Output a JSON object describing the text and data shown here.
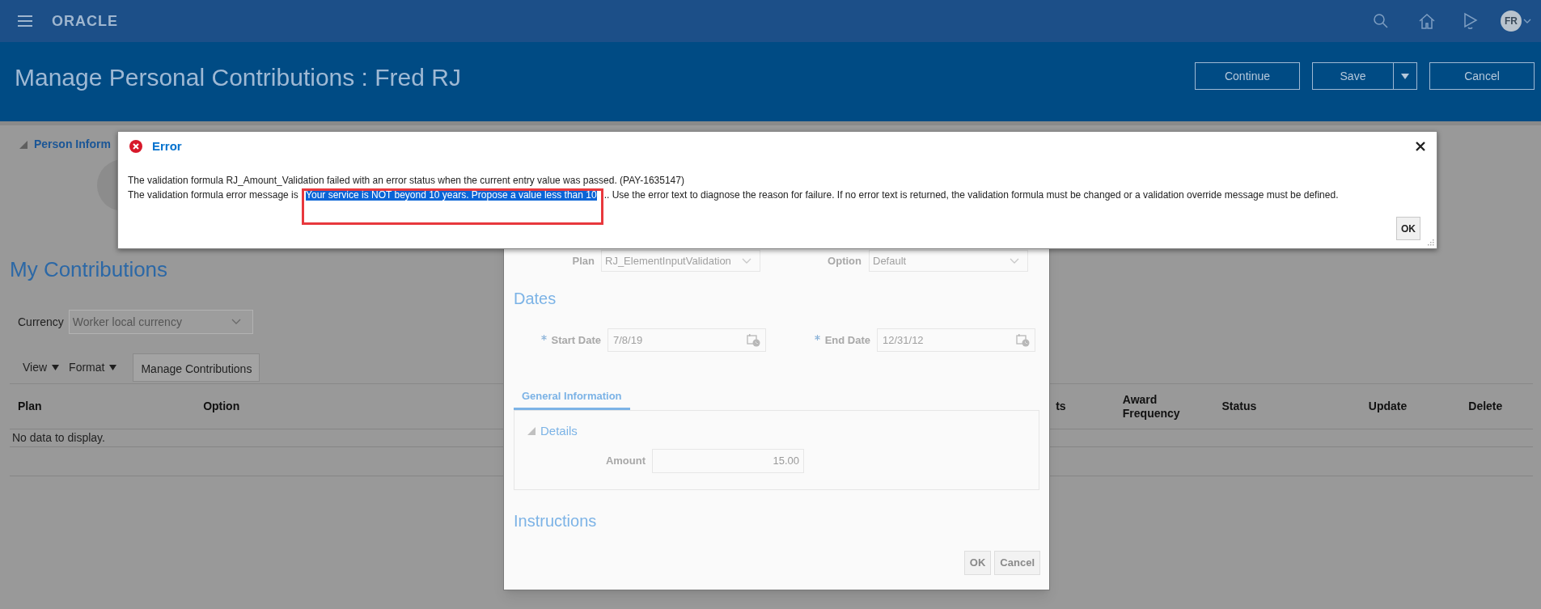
{
  "header": {
    "logo": "ORACLE",
    "user_initials": "FR",
    "title": "Manage Personal Contributions : Fred RJ",
    "buttons": [
      {
        "label": "Continue",
        "kind": "plain"
      },
      {
        "label": "Save",
        "kind": "split"
      },
      {
        "label": "Cancel",
        "kind": "plain"
      }
    ]
  },
  "person_section": {
    "title": "Person Inform",
    "expanded": true
  },
  "contributions": {
    "title": "My Contributions",
    "currency_label": "Currency",
    "currency_value": "Worker local currency",
    "menus": [
      "View",
      "Format"
    ],
    "manage_button": "Manage Contributions",
    "columns": [
      "Plan",
      "Option",
      "ts",
      "Award Frequency",
      "Status",
      "Update",
      "Delete"
    ],
    "empty_text": "No data to display."
  },
  "edit_dialog": {
    "plan_label": "Plan",
    "plan_value": "RJ_ElementInputValidation",
    "option_label": "Option",
    "option_value": "Default",
    "dates_heading": "Dates",
    "dates": [
      {
        "label": "Start Date",
        "value": "7/8/19",
        "required": true
      },
      {
        "label": "End Date",
        "value": "12/31/12",
        "required": true
      }
    ],
    "tabs": [
      {
        "label": "General Information",
        "selected": true
      }
    ],
    "details": {
      "title": "Details",
      "expanded": true,
      "amount_label": "Amount",
      "amount_value": "15.00"
    },
    "instructions_heading": "Instructions",
    "buttons": [
      "OK",
      "Cancel"
    ]
  },
  "error_dialog": {
    "title": "Error",
    "line1": "The validation formula RJ_Amount_Validation failed with an error status when the current entry value was passed. (PAY-1635147)",
    "line2": {
      "before": "The validation formula error message is ",
      "selected_text": "Your service is NOT beyond 10 years. Propose a value less than 10",
      "after": "..  Use the error text to diagnose the reason for failure. If no error text is returned, the validation formula must be changed or a validation override message must be defined."
    },
    "highlight_frame": true,
    "ok_button": "OK"
  }
}
